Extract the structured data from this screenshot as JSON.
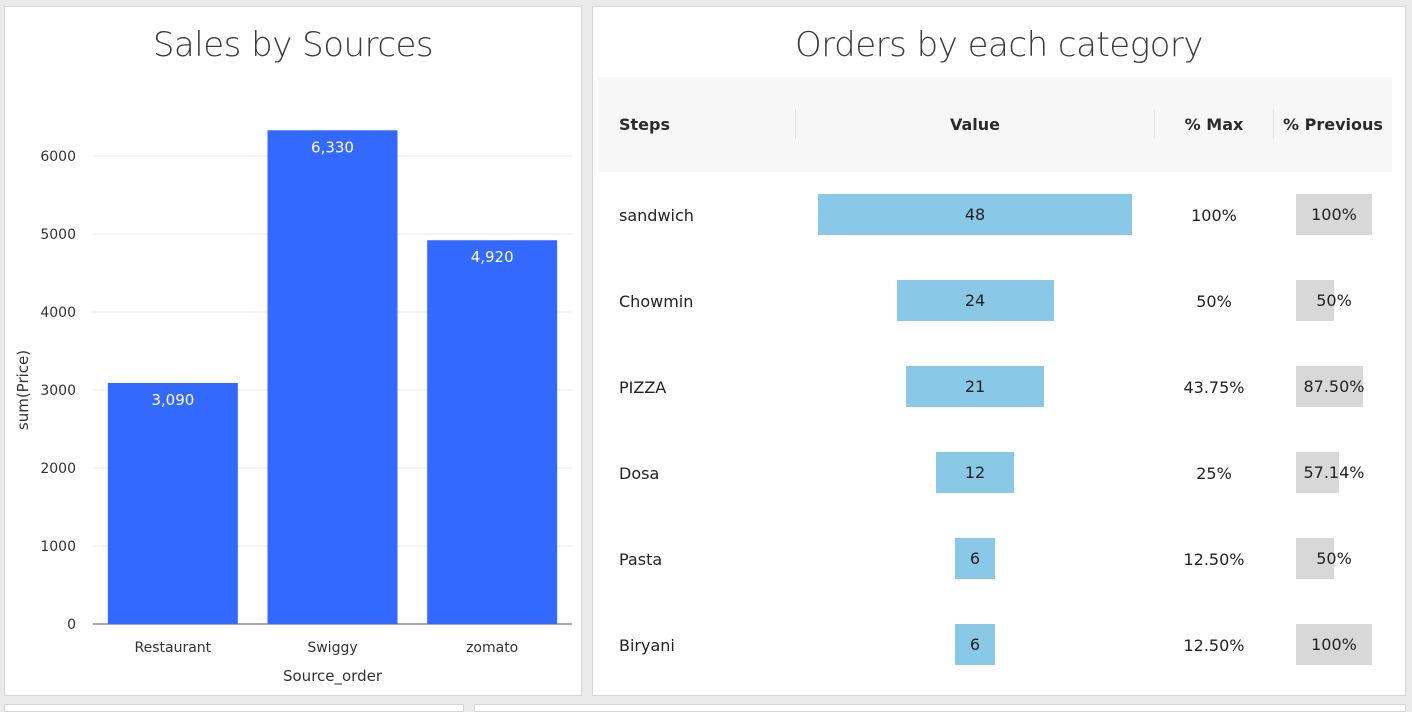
{
  "chart_data": [
    {
      "type": "bar",
      "title": "Sales by Sources",
      "categories": [
        "Restaurant",
        "Swiggy",
        "zomato"
      ],
      "values": [
        3090,
        6330,
        4920
      ],
      "value_labels": [
        "3,090",
        "6,330",
        "4,920"
      ],
      "xlabel": "Source_order",
      "ylabel": "sum(Price)",
      "ylim": [
        0,
        6500
      ],
      "yticks": [
        0,
        1000,
        2000,
        3000,
        4000,
        5000,
        6000
      ],
      "grid": true,
      "bar_color": "#3469ff"
    },
    {
      "type": "table",
      "title": "Orders by each category",
      "columns": [
        "Steps",
        "Value",
        "% Max",
        "% Previous"
      ],
      "rows": [
        {
          "step": "sandwich",
          "value": 48,
          "pct_max": "100%",
          "pct_prev": "100%",
          "prev_fill": 1.0
        },
        {
          "step": "Chowmin",
          "value": 24,
          "pct_max": "50%",
          "pct_prev": "50%",
          "prev_fill": 0.5
        },
        {
          "step": "PIZZA",
          "value": 21,
          "pct_max": "43.75%",
          "pct_prev": "87.50%",
          "prev_fill": 0.875
        },
        {
          "step": "Dosa",
          "value": 12,
          "pct_max": "25%",
          "pct_prev": "57.14%",
          "prev_fill": 0.5714
        },
        {
          "step": "Pasta",
          "value": 6,
          "pct_max": "12.50%",
          "pct_prev": "50%",
          "prev_fill": 0.5
        },
        {
          "step": "Biryani",
          "value": 6,
          "pct_max": "12.50%",
          "pct_prev": "100%",
          "prev_fill": 1.0
        }
      ],
      "bar_color": "#89c8e6",
      "prev_color": "#d8d8d8"
    }
  ]
}
